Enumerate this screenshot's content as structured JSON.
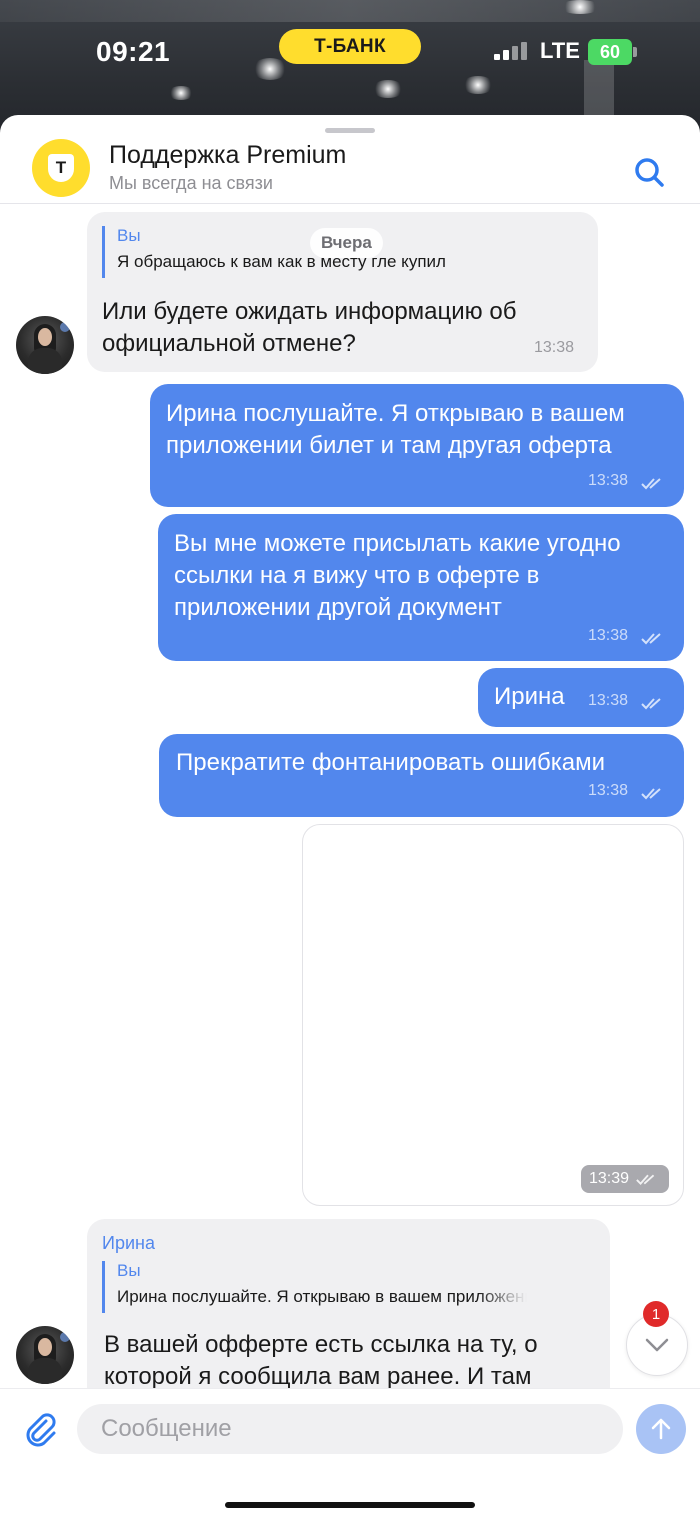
{
  "status_bar": {
    "time": "09:21",
    "carrier_badge": "Т-БАНК",
    "network": "LTE",
    "battery": "60"
  },
  "header": {
    "title": "Поддержка Premium",
    "subtitle": "Мы всегда на связи",
    "avatar_letter": "Т"
  },
  "date_separator": "Вчера",
  "messages": [
    {
      "direction": "incoming",
      "reply_author": "Вы",
      "reply_text": "Я обращаюсь к вам как в месту гле купил",
      "text": "Или будете ожидать информацию об официальной отмене?",
      "time": "13:38"
    },
    {
      "direction": "outgoing",
      "text": "Ирина послушайте. Я открываю в вашем приложении билет и там другая оферта",
      "time": "13:38"
    },
    {
      "direction": "outgoing",
      "text": "Вы мне можете присылать какие угодно ссылки на я вижу что в оферте в приложении другой документ",
      "time": "13:38"
    },
    {
      "direction": "outgoing",
      "text": "Ирина",
      "time": "13:38"
    },
    {
      "direction": "outgoing",
      "text": "Прекратите фонтанировать ошибками",
      "time": "13:38"
    },
    {
      "direction": "outgoing",
      "type": "image",
      "time": "13:39"
    },
    {
      "direction": "incoming",
      "sender": "Ирина",
      "reply_author": "Вы",
      "reply_text": "Ирина послушайте. Я открываю в вашем приложении",
      "text": "В вашей офферте есть ссылка на ту, о которой я сообщила вам ранее. И там"
    }
  ],
  "scroll_button": {
    "unread_count": "1"
  },
  "composer": {
    "placeholder": "Сообщение"
  },
  "colors": {
    "accent": "#5287ed",
    "brand_yellow": "#ffdd2d",
    "incoming_bubble": "#f0f0f2",
    "badge_red": "#e02a2a"
  },
  "icons": [
    "search-icon",
    "paperclip-icon",
    "send-arrow-icon",
    "chevron-down-icon",
    "double-check-icon"
  ]
}
